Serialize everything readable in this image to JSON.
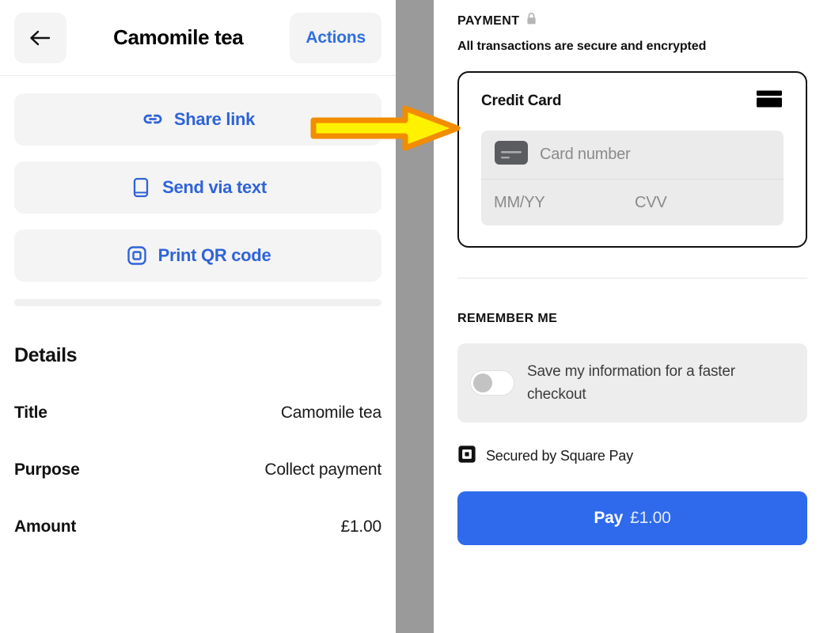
{
  "left": {
    "header": {
      "back_icon": "arrow-left-icon",
      "title": "Camomile tea",
      "actions_label": "Actions"
    },
    "share_actions": [
      {
        "icon": "link-icon",
        "label": "Share link"
      },
      {
        "icon": "phone-icon",
        "label": "Send via text"
      },
      {
        "icon": "qr-code-icon",
        "label": "Print QR code"
      }
    ],
    "details": {
      "heading": "Details",
      "rows": [
        {
          "label": "Title",
          "value": "Camomile tea"
        },
        {
          "label": "Purpose",
          "value": "Collect payment"
        },
        {
          "label": "Amount",
          "value": "£1.00"
        }
      ]
    }
  },
  "right": {
    "payment": {
      "section_title": "PAYMENT",
      "lock_icon": "lock-icon",
      "secure_note": "All transactions are secure and encrypted"
    },
    "card": {
      "title": "Credit Card",
      "brand_icon": "credit-card-icon",
      "card_number_placeholder": "Card number",
      "card_number_icon": "credit-card-icon",
      "expiry_placeholder": "MM/YY",
      "cvv_placeholder": "CVV"
    },
    "remember": {
      "section_title": "REMEMBER ME",
      "toggle_state": "off",
      "text": "Save my information for a faster checkout"
    },
    "secured": {
      "icon": "square-logo-icon",
      "text": "Secured by Square Pay"
    },
    "pay_button": {
      "label": "Pay",
      "amount": "£1.00"
    }
  },
  "annotation": {
    "arrow": "right-arrow-annotation",
    "fill": "#FFF200",
    "stroke": "#F28C00"
  },
  "colors": {
    "accent_blue": "#2f64d8",
    "pay_blue": "#2f6aec",
    "divider_gray": "#9a9a9a",
    "field_gray": "#ebebeb"
  }
}
